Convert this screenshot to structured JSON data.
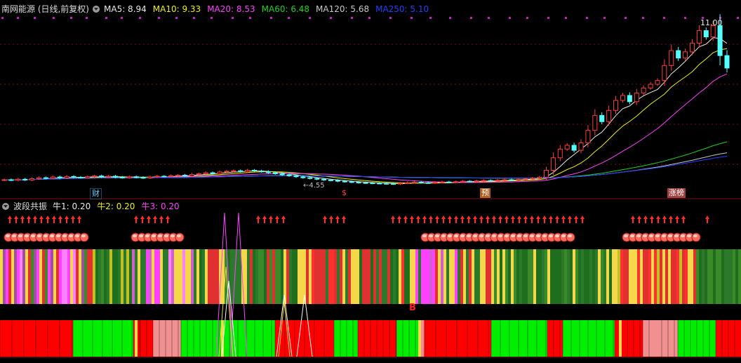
{
  "main_panel": {
    "title": "南网能源 (日线,前复权)",
    "indicators": [
      {
        "label": "MA5: 8.94",
        "color": "#e8e8e8"
      },
      {
        "label": "MA10: 9.33",
        "color": "#f0f000"
      },
      {
        "label": "MA20: 8.53",
        "color": "#ff40ff"
      },
      {
        "label": "MA60: 6.48",
        "color": "#20d020"
      },
      {
        "label": "MA120: 5.68",
        "color": "#c8c8c8"
      },
      {
        "label": "MA250: 5.10",
        "color": "#2040ff"
      }
    ],
    "max_label": "11.00",
    "min_label": "←4.55",
    "markers": [
      {
        "text": "财",
        "color": "#6ad0ff"
      },
      {
        "text": "$",
        "color": "#ff4040"
      },
      {
        "text": "预",
        "color": "#ff8030"
      },
      {
        "text": "涨榜",
        "color": "#ffffff"
      }
    ]
  },
  "sub_panel": {
    "title": "波段共振",
    "indicators": [
      {
        "label": "牛1: 0.20",
        "color": "#e8e8e8"
      },
      {
        "label": "牛2: 0.20",
        "color": "#f0f000"
      },
      {
        "label": "牛3: 0.20",
        "color": "#ff40ff"
      }
    ],
    "b_label": "B"
  },
  "colors": {
    "up": "#ff3c3c",
    "down": "#54ffff",
    "ma5": "#e8e8e8",
    "ma10": "#f0f000",
    "ma20": "#ff40ff",
    "ma60": "#20d020",
    "ma120": "#c8c8c8",
    "ma250": "#2040ff",
    "grid": "#7a1010"
  },
  "chart_data": {
    "type": "candlestick",
    "y_range": [
      4.55,
      11.0
    ],
    "closes": [
      4.72,
      4.7,
      4.74,
      4.71,
      4.76,
      4.8,
      4.78,
      4.83,
      4.79,
      4.85,
      4.82,
      4.8,
      4.84,
      4.87,
      4.83,
      4.86,
      4.82,
      4.8,
      4.84,
      4.81,
      4.79,
      4.83,
      4.86,
      4.85,
      4.88,
      4.9,
      4.87,
      4.93,
      4.96,
      5.0,
      4.97,
      5.03,
      5.06,
      5.08,
      5.05,
      5.1,
      5.07,
      5.04,
      5.0,
      4.96,
      4.92,
      4.88,
      4.84,
      4.8,
      4.77,
      4.74,
      4.71,
      4.69,
      4.66,
      4.64,
      4.62,
      4.6,
      4.59,
      4.58,
      4.57,
      4.56,
      4.55,
      4.58,
      4.6,
      4.62,
      4.6,
      4.59,
      4.61,
      4.63,
      4.62,
      4.64,
      4.66,
      4.65,
      4.67,
      4.69,
      4.68,
      4.7,
      4.72,
      4.71,
      4.73,
      4.75,
      4.78,
      4.82,
      5.1,
      5.6,
      5.95,
      6.1,
      5.9,
      6.2,
      6.7,
      7.3,
      7.05,
      7.5,
      7.9,
      8.1,
      7.85,
      8.2,
      8.4,
      8.55,
      8.7,
      9.3,
      9.9,
      9.6,
      9.85,
      10.2,
      10.7,
      10.45,
      10.9,
      9.7,
      9.2
    ]
  }
}
